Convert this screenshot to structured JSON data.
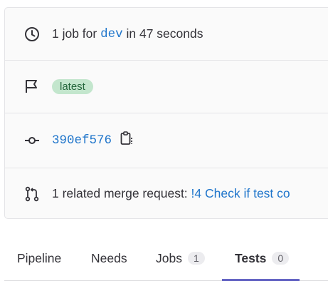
{
  "info": {
    "duration": {
      "icon": "clock-icon",
      "prefix": "1 job for",
      "ref": "dev",
      "suffix": "in 47 seconds"
    },
    "tags": {
      "icon": "flag-icon",
      "badge": "latest"
    },
    "commit": {
      "icon": "commit-icon",
      "sha": "390ef576",
      "copy_icon": "copy-to-clipboard-icon"
    },
    "merge_request": {
      "icon": "merge-request-icon",
      "prefix": "1 related merge request:",
      "link": "!4 Check if test co"
    }
  },
  "tabs": [
    {
      "label": "Pipeline"
    },
    {
      "label": "Needs"
    },
    {
      "label": "Jobs",
      "count": "1"
    },
    {
      "label": "Tests",
      "count": "0",
      "active": true
    }
  ],
  "colors": {
    "link": "#1f75cb",
    "badge_bg": "#c3e6cd",
    "badge_text": "#24663b",
    "active_tab_border": "#6666c4"
  }
}
